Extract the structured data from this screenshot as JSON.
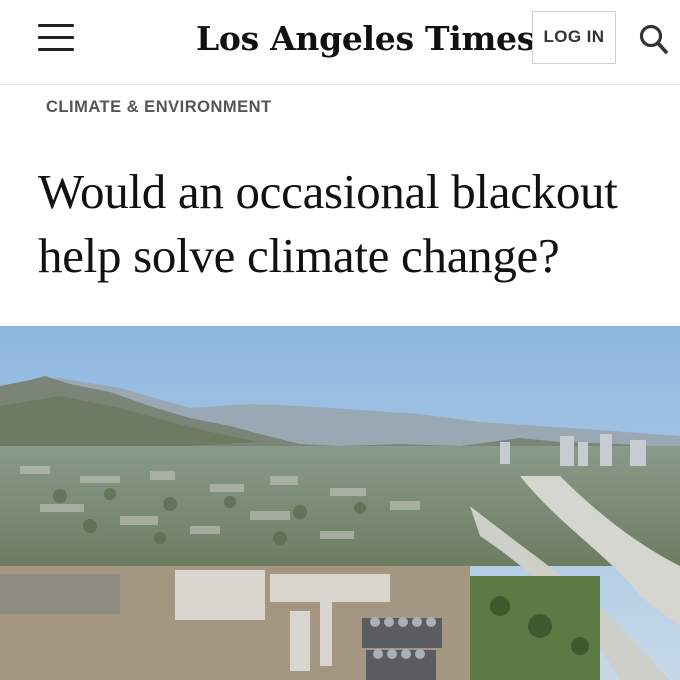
{
  "header": {
    "masthead": "Los Angeles Times",
    "login_label": "LOG IN",
    "menu_icon": "hamburger-menu-icon",
    "search_icon": "search-icon"
  },
  "article": {
    "section": "CLIMATE & ENVIRONMENT",
    "headline": "Would an occasional blackout help solve climate change?"
  },
  "colors": {
    "text": "#111111",
    "section": "#555555",
    "border": "#cfcfcf",
    "sky": "#a9c8e6"
  }
}
